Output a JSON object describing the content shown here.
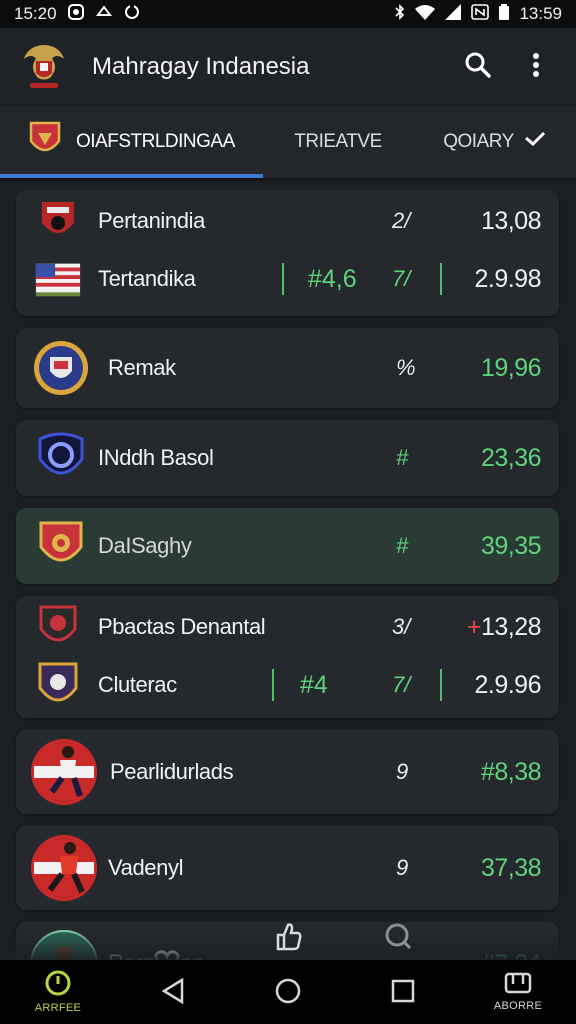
{
  "status_bar": {
    "time": "15:20",
    "time2": "13:59"
  },
  "app_bar": {
    "title": "Mahragay Indanesia"
  },
  "tabs": [
    {
      "label": "OIAFSTRLDINGAA"
    },
    {
      "label": "TRIEATVE"
    },
    {
      "label": "QOIARY"
    }
  ],
  "cards": [
    {
      "rows": [
        {
          "name": "Pertanindia",
          "mark": "2/",
          "value": "13,08"
        },
        {
          "name": "Tertandika",
          "mid": "#4,6",
          "mark": "7/",
          "value": "2.9.98"
        }
      ]
    },
    {
      "rows": [
        {
          "name": "Remak",
          "mark": "%",
          "value": "19,96"
        }
      ]
    },
    {
      "rows": [
        {
          "name": "INddh Basol",
          "mark": "#",
          "value": "23,36"
        }
      ]
    },
    {
      "rows": [
        {
          "name": "DaISaghy",
          "mark": "#",
          "value": "39,35"
        }
      ]
    },
    {
      "rows": [
        {
          "name": "Pbactas Denantal",
          "mark": "3/",
          "value_prefix": "+",
          "value": "13,28"
        },
        {
          "name": "Cluterac",
          "mid": "#4",
          "mark": "7/",
          "value": "2.9.96"
        }
      ]
    },
    {
      "rows": [
        {
          "name": "Pearlidurlads",
          "mark": "9",
          "value": "#8,38"
        }
      ]
    },
    {
      "rows": [
        {
          "name": "Vadenyl",
          "mark": "9",
          "value": "37,38"
        }
      ]
    },
    {
      "rows": [
        {
          "name": "Rarg",
          "name2": "an",
          "value": "#7,24"
        }
      ]
    }
  ],
  "nav": {
    "home_label": "ARRFEE",
    "right_label": "ABORRE"
  },
  "colors": {
    "accent_blue": "#3a7bd5",
    "green": "#5fd37a",
    "red": "#e64545",
    "nav_home": "#b6d83a"
  }
}
